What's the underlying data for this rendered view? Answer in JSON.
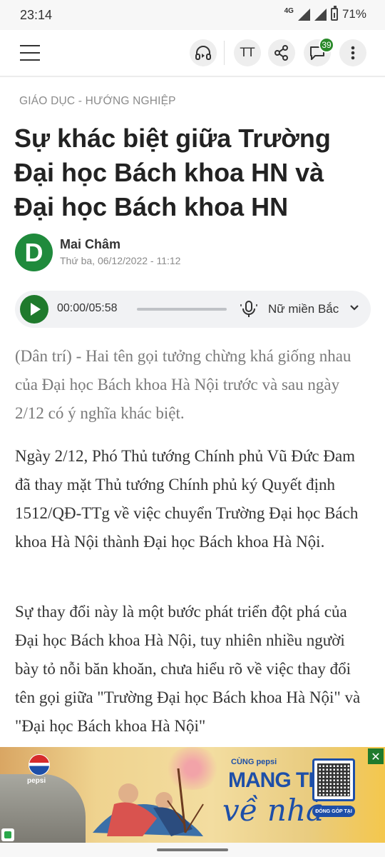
{
  "status_bar": {
    "time": "23:14",
    "network": "4G",
    "battery": "71%"
  },
  "toolbar": {
    "comment_count": "39",
    "text_size_icon": "TT"
  },
  "article": {
    "category": "GIÁO DỤC - HƯỚNG NGHIỆP",
    "title": "Sự khác biệt giữa Trường Đại học Bách khoa HN và Đại học Bách khoa HN",
    "author": {
      "logo_letter": "D",
      "name": "Mai Châm",
      "date": "Thứ ba, 06/12/2022 - 11:12"
    },
    "audio": {
      "time": "00:00/05:58",
      "progress": 0,
      "voice": "Nữ miền Bắc"
    },
    "paragraphs": [
      "(Dân trí) - Hai tên gọi tưởng chừng khá giống nhau của Đại học Bách khoa Hà Nội trước và sau ngày 2/12 có ý nghĩa khác biệt.",
      "Ngày 2/12, Phó Thủ tướng Chính phủ Vũ Đức Đam đã thay mặt Thủ tướng Chính phủ ký Quyết định 1512/QĐ-TTg về việc chuyển Trường Đại học Bách khoa Hà Nội thành Đại học Bách khoa Hà Nội.",
      "Sự thay đổi này là một bước phát triển đột phá của Đại học Bách khoa Hà Nội, tuy nhiên nhiều người bày tỏ nỗi băn khoăn, chưa hiểu rõ về việc thay đổi tên gọi giữa \"Trường Đại học Bách khoa Hà Nội\" và \"Đại học Bách khoa Hà Nội\""
    ]
  },
  "ad": {
    "brand": "pepsi",
    "tagline_small": "CÙNG pepsi",
    "tagline_big": "MANG TẾT",
    "tagline_script": "về nhà",
    "cta": "ĐÓNG GÓP TẠI",
    "close_label": "✕"
  },
  "colors": {
    "accent_green": "#1f7a2c",
    "badge_green": "#2a8a2a",
    "pepsi_blue": "#1e4fa8"
  }
}
